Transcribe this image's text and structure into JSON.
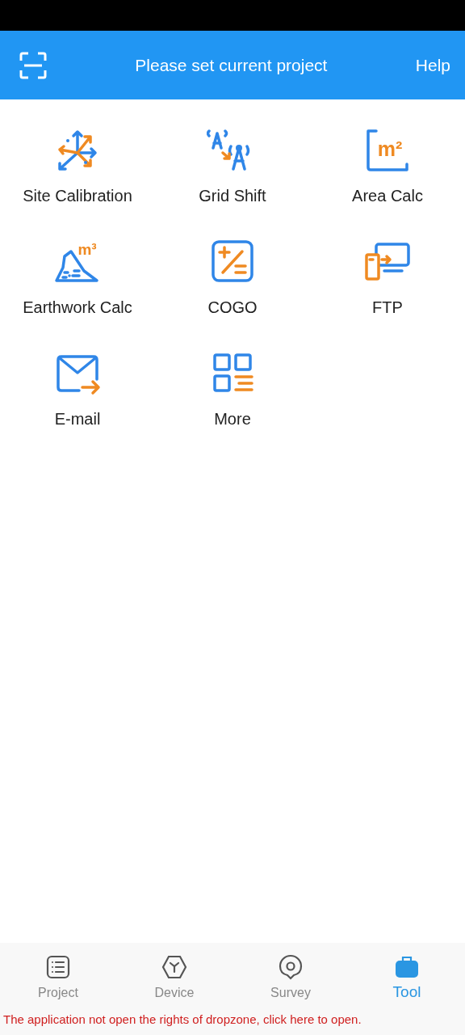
{
  "header": {
    "title": "Please set current project",
    "help": "Help"
  },
  "tools": [
    {
      "kind": "calibration",
      "label": "Site Calibration"
    },
    {
      "kind": "gridshift",
      "label": "Grid Shift"
    },
    {
      "kind": "area",
      "label": "Area Calc",
      "unit": "m²"
    },
    {
      "kind": "earthwork",
      "label": "Earthwork Calc",
      "unit": "m³"
    },
    {
      "kind": "cogo",
      "label": "COGO"
    },
    {
      "kind": "ftp",
      "label": "FTP"
    },
    {
      "kind": "email",
      "label": "E-mail"
    },
    {
      "kind": "more",
      "label": "More"
    }
  ],
  "nav": [
    {
      "kind": "project",
      "label": "Project",
      "selected": false
    },
    {
      "kind": "device",
      "label": "Device",
      "selected": false
    },
    {
      "kind": "survey",
      "label": "Survey",
      "selected": false
    },
    {
      "kind": "tool",
      "label": "Tool",
      "selected": true
    }
  ],
  "notice": "The application not open the rights of dropzone, click here to open."
}
